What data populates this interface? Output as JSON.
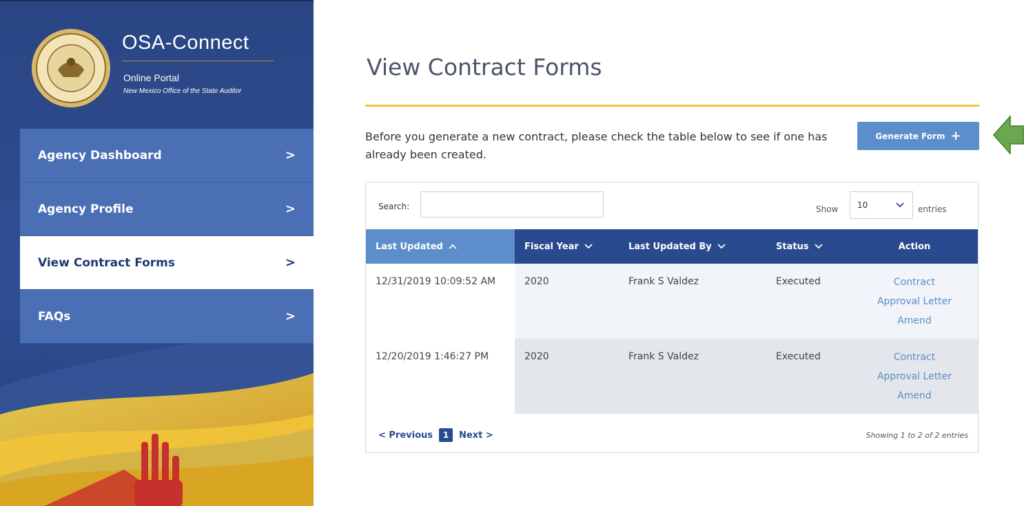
{
  "brand": {
    "title": "OSA-Connect",
    "subtitle": "Online Portal",
    "tagline": "New Mexico Office of the State Auditor",
    "seal_icon": "state-of-new-mexico-state-auditor-seal"
  },
  "sidebar": {
    "items": [
      {
        "label": "Agency Dashboard",
        "active": false
      },
      {
        "label": "Agency Profile",
        "active": false
      },
      {
        "label": "View Contract Forms",
        "active": true
      },
      {
        "label": "FAQs",
        "active": false
      }
    ],
    "chevron": ">"
  },
  "main": {
    "title": "View Contract Forms",
    "intro": "Before you generate a new contract, please check the table below to see if one has already been created.",
    "generate_button": "Generate Form",
    "generate_icon": "+"
  },
  "table": {
    "search_label": "Search:",
    "search_value": "",
    "show_label": "Show",
    "page_size": "10",
    "entries_label": "entries",
    "columns": [
      "Last Updated",
      "Fiscal Year",
      "Last Updated By",
      "Status",
      "Action"
    ],
    "sort_asc_icon": "^",
    "sort_down_icon": "v",
    "rows": [
      {
        "last_updated": "12/31/2019 10:09:52 AM",
        "fiscal_year": "2020",
        "updated_by": "Frank S Valdez",
        "status": "Executed",
        "actions": [
          "Contract",
          "Approval Letter",
          "Amend"
        ]
      },
      {
        "last_updated": "12/20/2019 1:46:27 PM",
        "fiscal_year": "2020",
        "updated_by": "Frank S Valdez",
        "status": "Executed",
        "actions": [
          "Contract",
          "Approval Letter",
          "Amend"
        ]
      }
    ],
    "pager": {
      "previous": "< Previous",
      "current": "1",
      "next": "Next >"
    },
    "showing": "Showing 1 to 2 of 2 entries"
  },
  "colors": {
    "sidebar": "#2c4a8c",
    "nav_item": "#4a6fb5",
    "accent_yellow": "#f1c232",
    "button_blue": "#5b8ecb",
    "header_navy": "#2a4a8f",
    "annotation_arrow": "#6aa84f"
  }
}
